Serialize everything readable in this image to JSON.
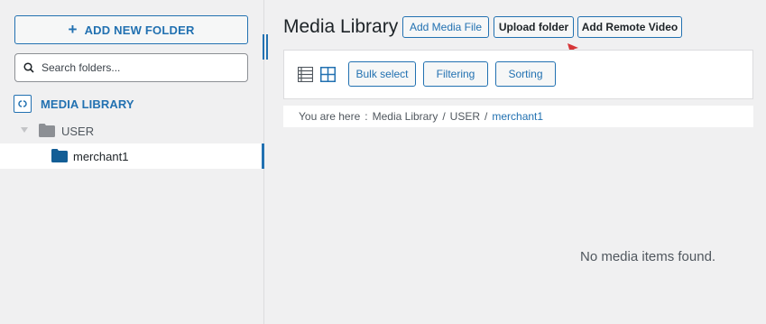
{
  "sidebar": {
    "add_folder_label": "ADD NEW FOLDER",
    "search_placeholder": "Search folders...",
    "root_label": "MEDIA LIBRARY",
    "tree": [
      {
        "label": "USER",
        "expanded": true
      },
      {
        "label": "merchant1",
        "selected": true
      }
    ]
  },
  "header": {
    "title": "Media Library",
    "buttons": {
      "add_media": "Add Media File",
      "upload_folder": "Upload folder",
      "add_remote_video": "Add Remote Video"
    }
  },
  "toolbar": {
    "bulk_select": "Bulk select",
    "filtering": "Filtering",
    "sorting": "Sorting"
  },
  "breadcrumb": {
    "prefix": "You are here",
    "colon": ":",
    "items": [
      "Media Library",
      "USER",
      "merchant1"
    ],
    "separator": "/"
  },
  "main": {
    "empty_message": "No media items found."
  },
  "colors": {
    "accent": "#2271b1",
    "annotation_arrow": "#d63638",
    "folder": "#8c8f94",
    "folder_selected": "#135e96"
  }
}
